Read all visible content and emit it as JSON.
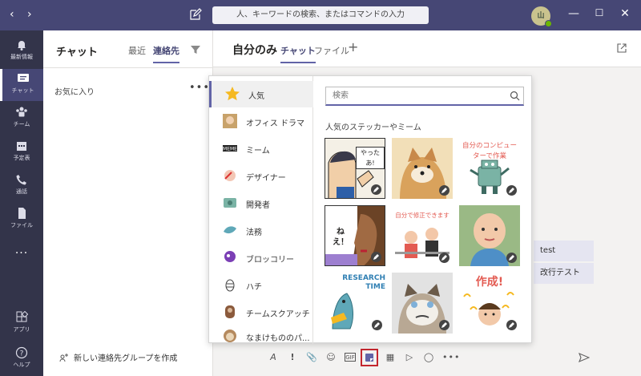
{
  "search": {
    "placeholder": "人、キーワードの検索、またはコマンドの入力"
  },
  "user": {
    "initials": "山"
  },
  "rail": [
    {
      "label": "最新情報",
      "icon": "bell-icon"
    },
    {
      "label": "チャット",
      "icon": "chat-icon"
    },
    {
      "label": "チーム",
      "icon": "teams-icon"
    },
    {
      "label": "予定表",
      "icon": "calendar-icon"
    },
    {
      "label": "通話",
      "icon": "phone-icon"
    },
    {
      "label": "ファイル",
      "icon": "file-icon"
    },
    {
      "label": "...",
      "icon": "more-icon"
    },
    {
      "label": "アプリ",
      "icon": "apps-icon"
    },
    {
      "label": "ヘルプ",
      "icon": "help-icon"
    }
  ],
  "chatlist": {
    "title": "チャット",
    "tabs": [
      "最近",
      "連絡先"
    ],
    "favorites": "お気に入り",
    "more": "•••",
    "new_group": "新しい連絡先グループを作成"
  },
  "main": {
    "name": "自分のみ",
    "tabs": [
      "チャット",
      "ファイル"
    ],
    "add": "+",
    "messages": [
      "test",
      "改行テスト"
    ]
  },
  "stickers": {
    "search_placeholder": "検索",
    "section": "人気のステッカーやミーム",
    "categories": [
      "人気",
      "オフィス ドラマ",
      "ミーム",
      "デザイナー",
      "開発者",
      "法務",
      "ブロッコリー",
      "ハチ",
      "チームスクアッチ",
      "なまけもののパ..."
    ],
    "items": [
      {
        "text": "やったあ!"
      },
      {
        "text": ""
      },
      {
        "text": "自分のコンピューターで作業"
      },
      {
        "text": "ねえ！"
      },
      {
        "text": "自分で修正できます"
      },
      {
        "text": ""
      },
      {
        "text": "RESEARCH TIME"
      },
      {
        "text": ""
      },
      {
        "text": "作成!"
      }
    ]
  },
  "colors": {
    "titlebar": "#464775",
    "rail": "#33344a",
    "accent": "#6264a7",
    "highlight": "#c4262e"
  }
}
